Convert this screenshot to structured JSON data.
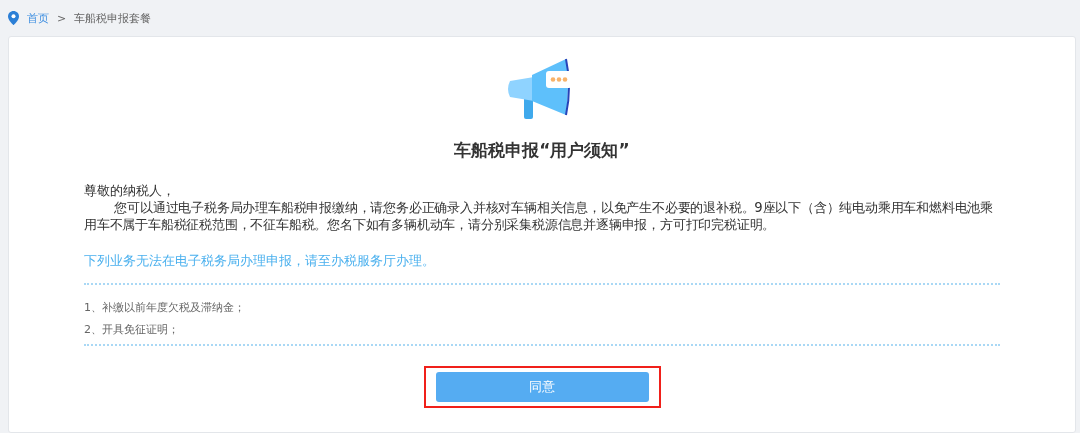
{
  "breadcrumb": [
    {
      "label": "首页",
      "kind": "link"
    },
    {
      "label": ">",
      "kind": "separator"
    },
    {
      "label": "车船税申报套餐",
      "kind": "current"
    }
  ],
  "notice": {
    "title": "车船税申报“用户须知”",
    "greeting": "尊敬的纳税人，",
    "body": "您可以通过电子税务局办理车船税申报缴纳，请您务必正确录入并核对车辆相关信息，以免产生不必要的退补税。9座以下（含）纯电动乘用车和燃料电池乘用车不属于车船税征税范围，不征车船税。您名下如有多辆机动车，请分别采集税源信息并逐辆申报，方可打印完税证明。",
    "hint": "下列业务无法在电子税务局办理申报，请至办税服务厅办理。",
    "items": [
      "1、补缴以前年度欠税及滞纳金；",
      "2、开具免征证明；"
    ]
  },
  "button": {
    "label": "同意",
    "highlighted": true
  }
}
